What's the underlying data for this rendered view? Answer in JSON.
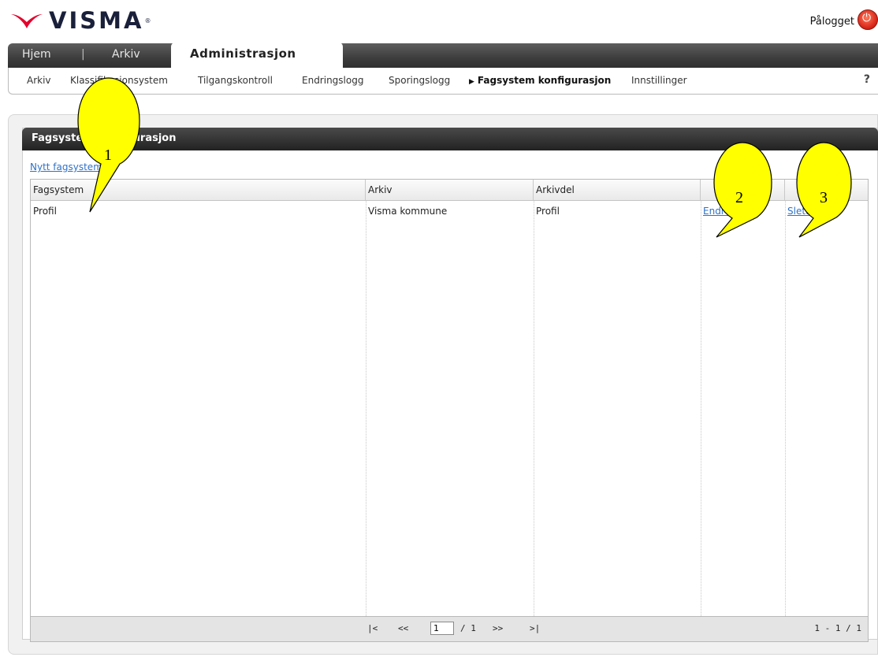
{
  "header": {
    "brand": "VISMA",
    "logged_in_label": "Pålogget",
    "brand_color": "#e4002b"
  },
  "main_tabs": [
    {
      "label": "Hjem"
    },
    {
      "label": "|"
    },
    {
      "label": "Arkiv"
    },
    {
      "label": "Administrasjon",
      "active": true
    }
  ],
  "sub_nav": [
    {
      "label": "Arkiv"
    },
    {
      "label": "Klassifikasjonsystem"
    },
    {
      "label": "Tilgangskontroll"
    },
    {
      "label": "Endringslogg"
    },
    {
      "label": "Sporingslogg"
    },
    {
      "label": "Fagsystem konfigurasjon",
      "active": true
    },
    {
      "label": "Innstillinger"
    }
  ],
  "help_label": "?",
  "panel": {
    "title": "Fagsystem konfigurasjon",
    "new_link": "Nytt fagsystem"
  },
  "table": {
    "columns": [
      "Fagsystem",
      "Arkiv",
      "Arkivdel",
      "",
      ""
    ],
    "rows": [
      {
        "fagsystem": "Profil",
        "arkiv": "Visma kommune",
        "arkivdel": "Profil",
        "edit": "Endre",
        "delete": "Slett"
      }
    ]
  },
  "pager": {
    "first": "|<",
    "prev": "<<",
    "page": "1",
    "of": "/ 1",
    "next": ">>",
    "last": ">|",
    "range": "1 - 1 / 1"
  },
  "callouts": [
    {
      "number": "1"
    },
    {
      "number": "2"
    },
    {
      "number": "3"
    }
  ],
  "colors": {
    "callout_fill": "#ffff00",
    "link": "#2f72c8"
  }
}
